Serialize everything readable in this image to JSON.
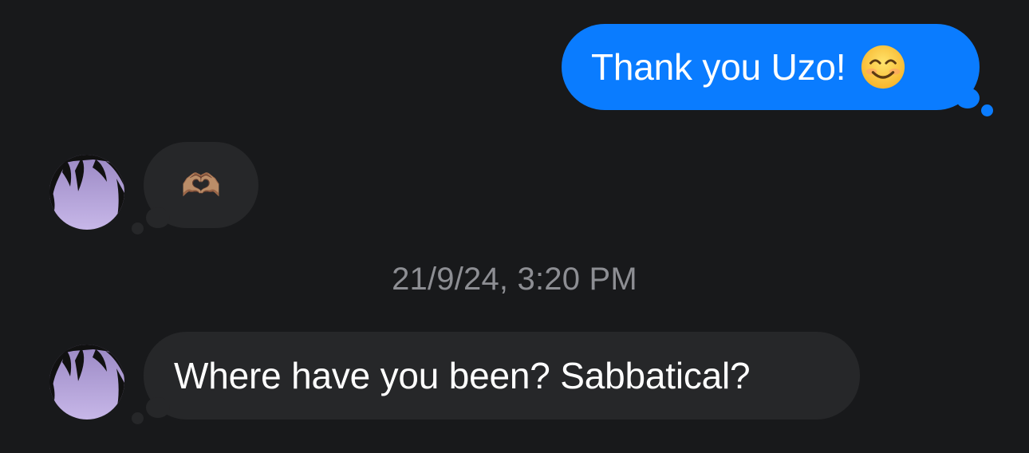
{
  "thread": {
    "messages": [
      {
        "direction": "outgoing",
        "text": "Thank you Uzo!",
        "trailing_emoji": "smiling-face-with-smiling-eyes"
      },
      {
        "direction": "incoming",
        "text": "🫶🏽",
        "emoji_name": "heart-hands-emoji"
      },
      {
        "direction": "incoming",
        "text": "Where have you been? Sabbatical?"
      }
    ],
    "timestamp": "21/9/24, 3:20 PM"
  },
  "colors": {
    "background": "#18191b",
    "outgoing_bubble": "#0a7cff",
    "incoming_bubble": "#262729",
    "timestamp_text": "#8d8e93"
  }
}
